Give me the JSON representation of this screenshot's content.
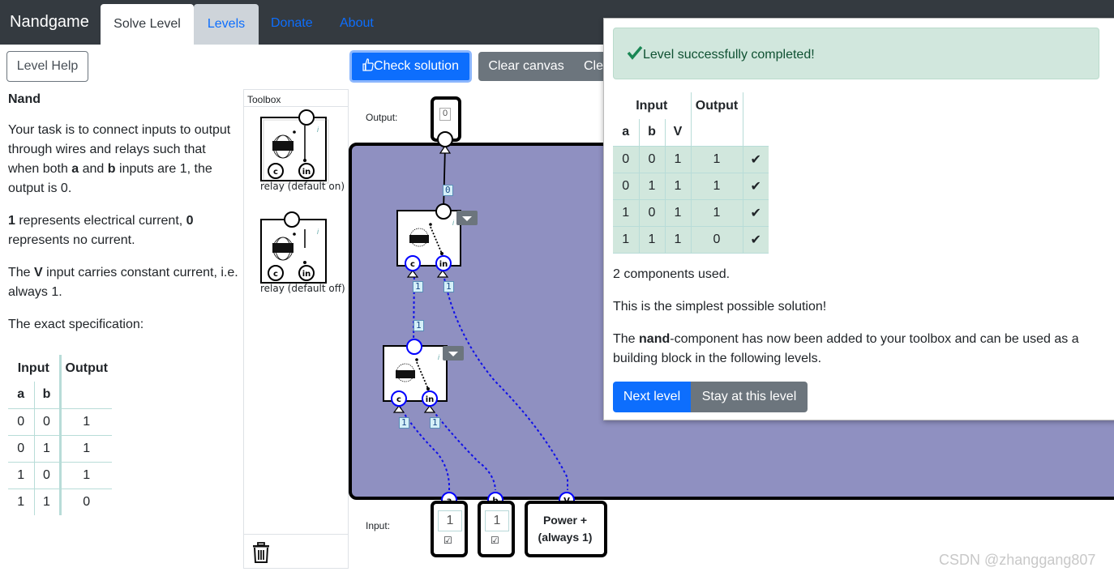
{
  "navbar": {
    "brand": "Nandgame",
    "tabs": [
      "Solve Level",
      "Levels"
    ],
    "links": [
      "Donate",
      "About"
    ]
  },
  "left": {
    "help_button": "Level Help",
    "title": "Nand",
    "p1_a": "Your task is to connect inputs to output through wires and relays such that when both ",
    "p1_b": "a",
    "p1_c": " and ",
    "p1_d": "b",
    "p1_e": " inputs are 1, the output is 0.",
    "p2_a": "1",
    "p2_b": " represents electrical current, ",
    "p2_c": "0",
    "p2_d": " represents no current.",
    "p3_a": "The ",
    "p3_b": "V",
    "p3_c": " input carries constant current, i.e. always 1.",
    "p4": "The exact specification:",
    "table": {
      "header_input": "Input",
      "header_output": "Output",
      "cols": [
        "a",
        "b"
      ],
      "rows": [
        [
          "0",
          "0",
          "1"
        ],
        [
          "0",
          "1",
          "1"
        ],
        [
          "1",
          "0",
          "1"
        ],
        [
          "1",
          "1",
          "0"
        ]
      ]
    }
  },
  "toolbar": {
    "check": "Check solution",
    "clear": "Clear canvas",
    "clear2": "Cle"
  },
  "toolbox": {
    "title": "Toolbox",
    "items": [
      "relay (default on)",
      "relay (default off)"
    ]
  },
  "canvas": {
    "output_label": "Output:",
    "input_label": "Input:",
    "output_value": "0",
    "inputs": [
      {
        "name": "a",
        "value": "1",
        "check": "☑"
      },
      {
        "name": "b",
        "value": "1",
        "check": "☑"
      }
    ],
    "power": {
      "name": "V",
      "line1": "Power +",
      "line2": "(always 1)"
    },
    "wire_values": [
      "0",
      "1",
      "1",
      "1",
      "1",
      "1"
    ],
    "relay_pins": [
      "c",
      "in"
    ],
    "info_glyph": "i"
  },
  "modal": {
    "alert": "Level successfully completed!",
    "table": {
      "header_input": "Input",
      "header_output": "Output",
      "cols": [
        "a",
        "b",
        "V"
      ],
      "rows": [
        [
          "0",
          "0",
          "1",
          "1",
          "✔"
        ],
        [
          "0",
          "1",
          "1",
          "1",
          "✔"
        ],
        [
          "1",
          "0",
          "1",
          "1",
          "✔"
        ],
        [
          "1",
          "1",
          "1",
          "0",
          "✔"
        ]
      ]
    },
    "components": "2 components used.",
    "simplest": "This is the simplest possible solution!",
    "toolbox_msg_a": "The ",
    "toolbox_msg_b": "nand",
    "toolbox_msg_c": "-component has now been added to your toolbox and can be used as a building block in the following levels.",
    "next_button": "Next level",
    "stay_button": "Stay at this level"
  },
  "watermark": "CSDN @zhanggang807",
  "colors": {
    "canvas_bg": "#8f90c1",
    "primary": "#0d6efd",
    "secondary": "#6c757d",
    "success_bg": "#d1e7dd",
    "navbar": "#343a40"
  }
}
